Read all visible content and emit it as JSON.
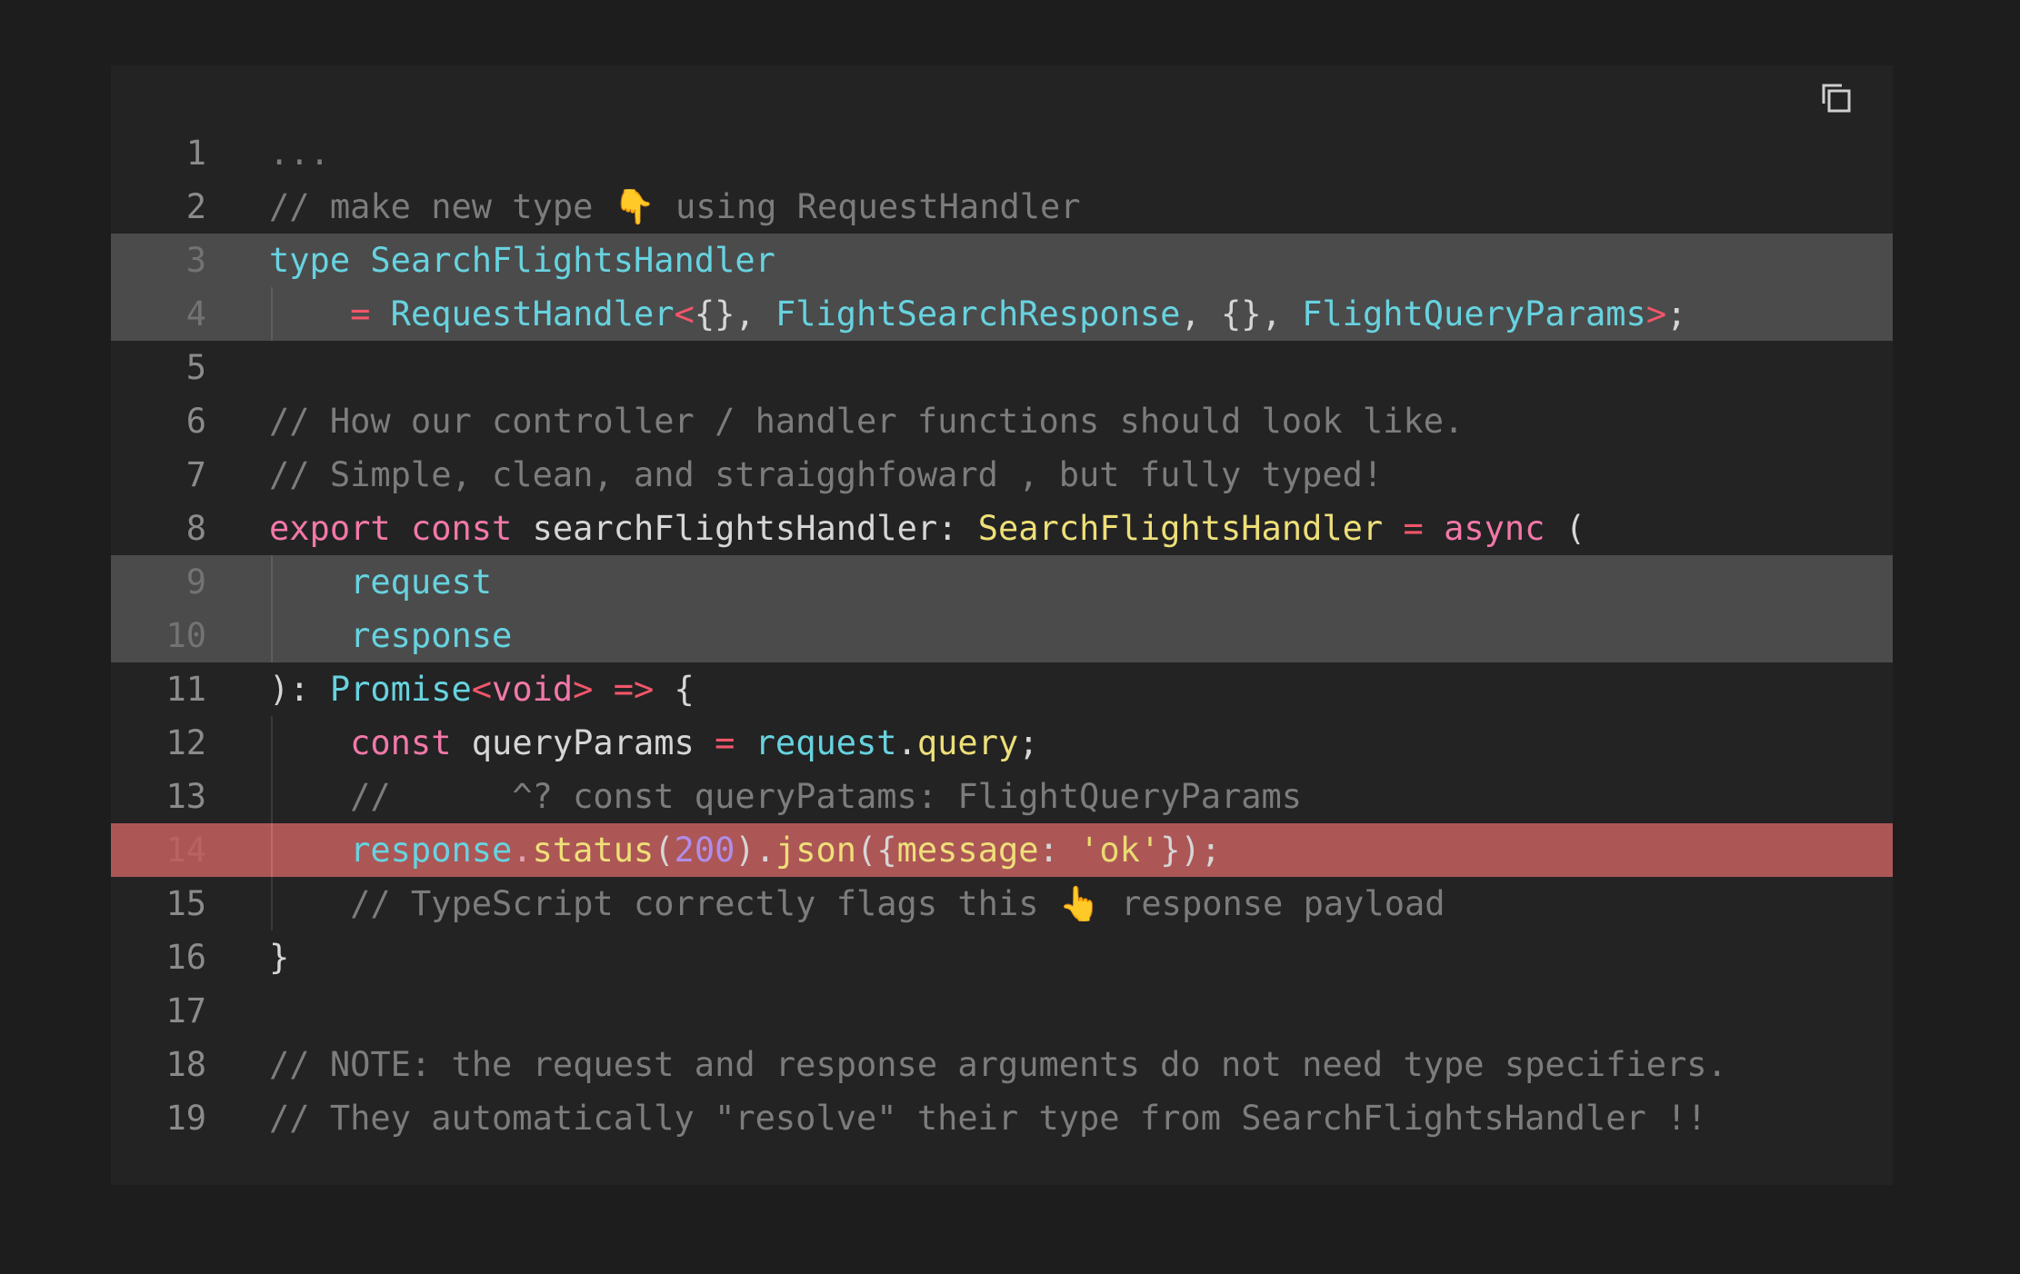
{
  "icons": {
    "copy": "copy-icon",
    "point_down": "👇",
    "point_up": "👆"
  },
  "colors": {
    "background": "#1d1d1e",
    "panel": "#232324",
    "line_highlight": "#4b4b4c",
    "error_highlight": "#ad5656",
    "comment": "#7c7c7c",
    "keyword": "#f278a8",
    "type": "#67d3df",
    "operator": "#f2566a",
    "function": "#eedf78",
    "number": "#b18de8"
  },
  "lines": [
    {
      "num": "1",
      "tokens": [
        {
          "t": "...",
          "c": "cm"
        }
      ]
    },
    {
      "num": "2",
      "tokens": [
        {
          "t": "// make new type ",
          "c": "cm"
        },
        {
          "t": "👇",
          "c": "emo"
        },
        {
          "t": " using RequestHandler",
          "c": "cm"
        }
      ]
    },
    {
      "num": "3",
      "hl": "gray",
      "tokens": [
        {
          "t": "type",
          "c": "ty"
        },
        {
          "t": " "
        },
        {
          "t": "SearchFlightsHandler",
          "c": "ty"
        }
      ]
    },
    {
      "num": "4",
      "hl": "gray",
      "guide": true,
      "tokens": [
        {
          "t": "    "
        },
        {
          "t": "=",
          "c": "op"
        },
        {
          "t": " "
        },
        {
          "t": "RequestHandler",
          "c": "ty"
        },
        {
          "t": "<",
          "c": "op"
        },
        {
          "t": "{}, ",
          "c": "pn"
        },
        {
          "t": "FlightSearchResponse",
          "c": "ty"
        },
        {
          "t": ", {}, ",
          "c": "pn"
        },
        {
          "t": "FlightQueryParams",
          "c": "ty"
        },
        {
          "t": ">",
          "c": "op"
        },
        {
          "t": ";",
          "c": "pn"
        }
      ]
    },
    {
      "num": "5",
      "tokens": []
    },
    {
      "num": "6",
      "tokens": [
        {
          "t": "// How our controller / handler functions should look like.",
          "c": "cm"
        }
      ]
    },
    {
      "num": "7",
      "tokens": [
        {
          "t": "// Simple, clean, and straigghfoward , but fully typed!",
          "c": "cm"
        }
      ]
    },
    {
      "num": "8",
      "tokens": [
        {
          "t": "export",
          "c": "kw"
        },
        {
          "t": " "
        },
        {
          "t": "const",
          "c": "kw"
        },
        {
          "t": " searchFlightsHandler: ",
          "c": "id"
        },
        {
          "t": "SearchFlightsHandler",
          "c": "fn"
        },
        {
          "t": " "
        },
        {
          "t": "=",
          "c": "op"
        },
        {
          "t": " "
        },
        {
          "t": "async",
          "c": "kw"
        },
        {
          "t": " (",
          "c": "pn"
        }
      ]
    },
    {
      "num": "9",
      "hl": "gray",
      "guide": true,
      "tokens": [
        {
          "t": "    "
        },
        {
          "t": "request",
          "c": "ty"
        }
      ]
    },
    {
      "num": "10",
      "hl": "gray",
      "guide": true,
      "tokens": [
        {
          "t": "    "
        },
        {
          "t": "response",
          "c": "ty"
        }
      ]
    },
    {
      "num": "11",
      "tokens": [
        {
          "t": "): ",
          "c": "pn"
        },
        {
          "t": "Promise",
          "c": "ty"
        },
        {
          "t": "<",
          "c": "op"
        },
        {
          "t": "void",
          "c": "kw"
        },
        {
          "t": ">",
          "c": "op"
        },
        {
          "t": " "
        },
        {
          "t": "=>",
          "c": "op"
        },
        {
          "t": " {",
          "c": "pn"
        }
      ]
    },
    {
      "num": "12",
      "guide": true,
      "tokens": [
        {
          "t": "    "
        },
        {
          "t": "const",
          "c": "kw"
        },
        {
          "t": " queryParams ",
          "c": "id"
        },
        {
          "t": "=",
          "c": "op"
        },
        {
          "t": " "
        },
        {
          "t": "request",
          "c": "ty"
        },
        {
          "t": ".",
          "c": "pn"
        },
        {
          "t": "query",
          "c": "fn"
        },
        {
          "t": ";",
          "c": "pn"
        }
      ]
    },
    {
      "num": "13",
      "guide": true,
      "tokens": [
        {
          "t": "    "
        },
        {
          "t": "//      ^? const queryPatams: FlightQueryParams",
          "c": "cm"
        }
      ]
    },
    {
      "num": "14",
      "hl": "red",
      "guide": true,
      "tokens": [
        {
          "t": "    "
        },
        {
          "t": "response",
          "c": "ty"
        },
        {
          "t": ".",
          "c": "op"
        },
        {
          "t": "status",
          "c": "fn"
        },
        {
          "t": "(",
          "c": "pn"
        },
        {
          "t": "200",
          "c": "nu"
        },
        {
          "t": ").",
          "c": "pn"
        },
        {
          "t": "json",
          "c": "fn"
        },
        {
          "t": "({",
          "c": "pn"
        },
        {
          "t": "message",
          "c": "fn"
        },
        {
          "t": ": ",
          "c": "pn"
        },
        {
          "t": "'ok'",
          "c": "st"
        },
        {
          "t": "});",
          "c": "pn"
        }
      ]
    },
    {
      "num": "15",
      "guide": true,
      "tokens": [
        {
          "t": "    "
        },
        {
          "t": "// TypeScript correctly flags this ",
          "c": "cm"
        },
        {
          "t": "👆",
          "c": "emo"
        },
        {
          "t": " response payload",
          "c": "cm"
        }
      ]
    },
    {
      "num": "16",
      "tokens": [
        {
          "t": "}",
          "c": "pn"
        }
      ]
    },
    {
      "num": "17",
      "tokens": []
    },
    {
      "num": "18",
      "tokens": [
        {
          "t": "// NOTE: the request and response arguments do not need type specifiers.",
          "c": "cm"
        }
      ]
    },
    {
      "num": "19",
      "tokens": [
        {
          "t": "// They automatically \"resolve\" their type from SearchFlightsHandler !!",
          "c": "cm"
        }
      ]
    }
  ]
}
